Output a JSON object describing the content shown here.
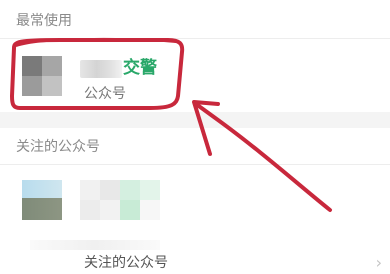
{
  "sections": {
    "frequent_title": "最常使用",
    "followed_title": "关注的公众号"
  },
  "frequent_item": {
    "name_suffix": "交警",
    "subtitle": "公众号"
  },
  "bottom_row": {
    "label": "关注的公众号",
    "chevron_icon": "chevron-right-icon"
  },
  "colors": {
    "accent_green": "#2aa86a",
    "annotation_red": "#c8283c"
  }
}
